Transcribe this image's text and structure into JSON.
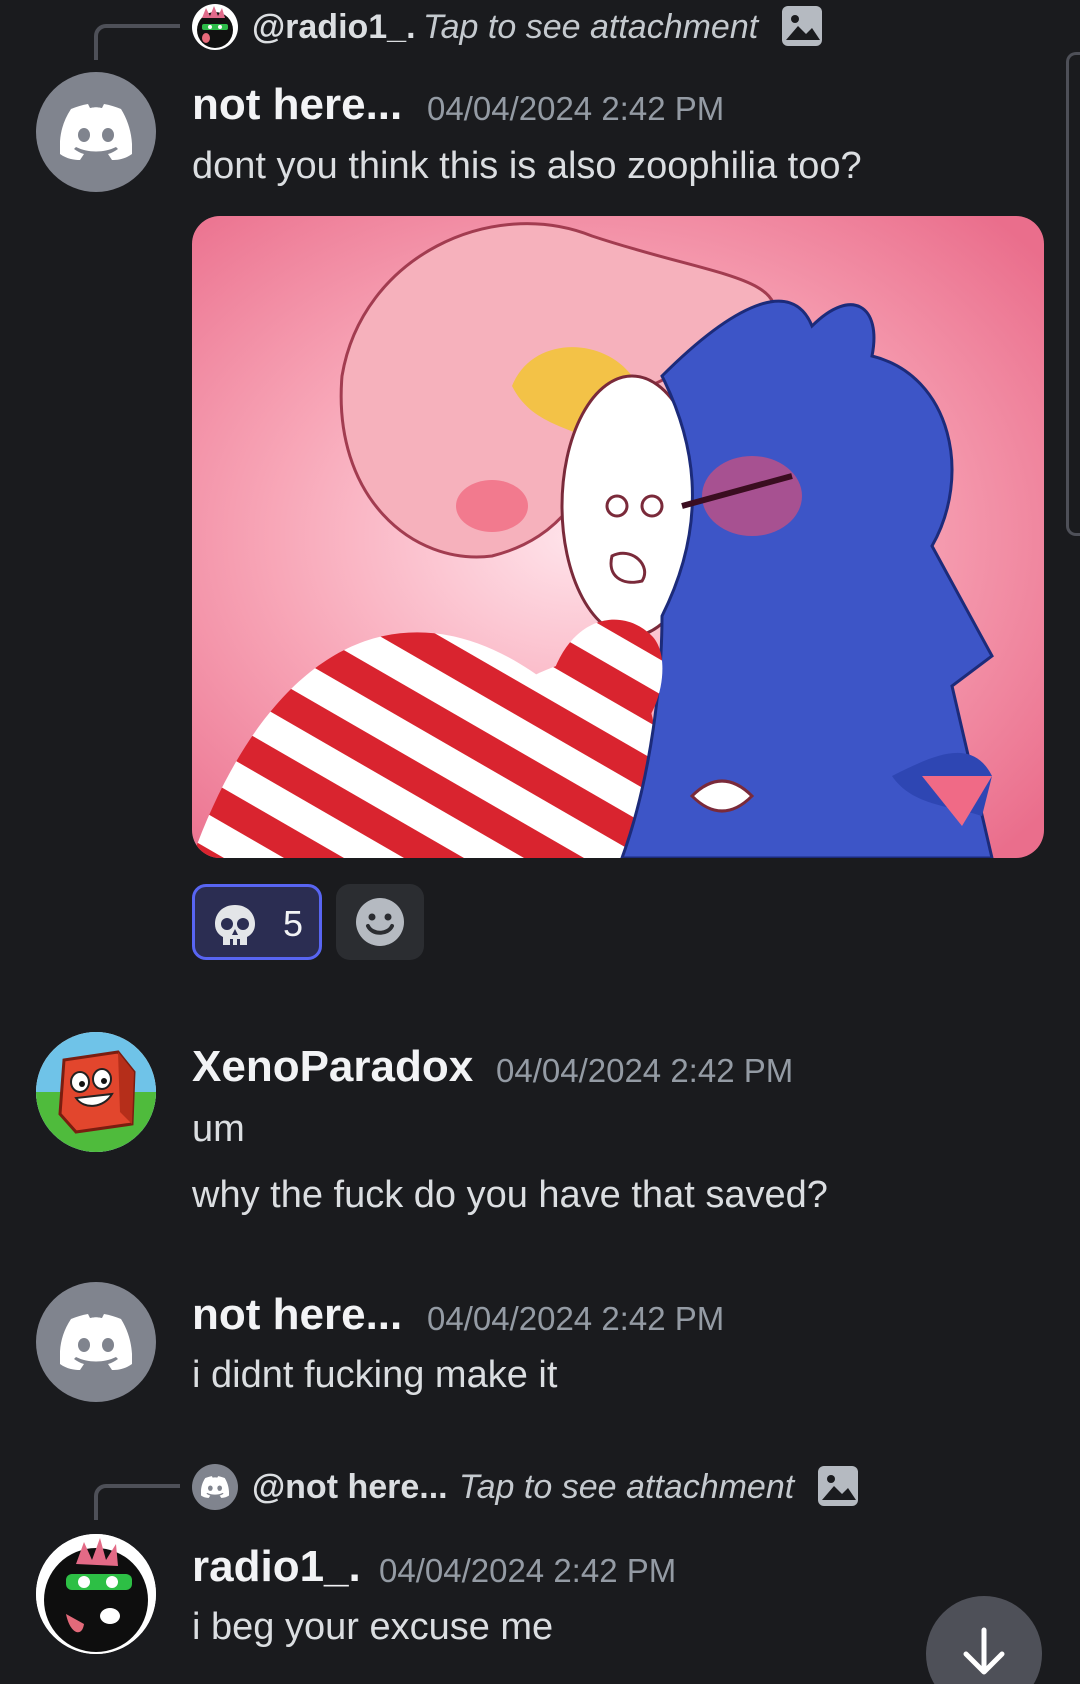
{
  "messages": [
    {
      "reply": {
        "name": "@radio1_.",
        "text": "Tap to see attachment"
      },
      "author": "not here...",
      "timestamp": "04/04/2024 2:42 PM",
      "lines": [
        "dont you think this is also zoophilia too?"
      ],
      "reactions": [
        {
          "emoji": "skull",
          "count": "5"
        }
      ]
    },
    {
      "author": "XenoParadox",
      "timestamp": "04/04/2024 2:42 PM",
      "lines": [
        "um",
        "why the fuck do you have that saved?"
      ]
    },
    {
      "author": "not here...",
      "timestamp": "04/04/2024 2:42 PM",
      "lines": [
        "i didnt fucking make it"
      ]
    },
    {
      "reply": {
        "name": "@not here...",
        "text": "Tap to see attachment"
      },
      "author": "radio1_.",
      "timestamp": "04/04/2024 2:42 PM",
      "lines": [
        "i beg your excuse me"
      ]
    }
  ],
  "icons": {
    "discord_avatar": "discord-logo-icon",
    "reaction_skull": "skull-icon",
    "add_reaction": "smile-icon",
    "attachment": "image-icon",
    "scroll_down": "arrow-down-icon"
  },
  "colors": {
    "background": "#1a1b1e",
    "accent": "#5865f2",
    "muted": "#949ba4"
  }
}
